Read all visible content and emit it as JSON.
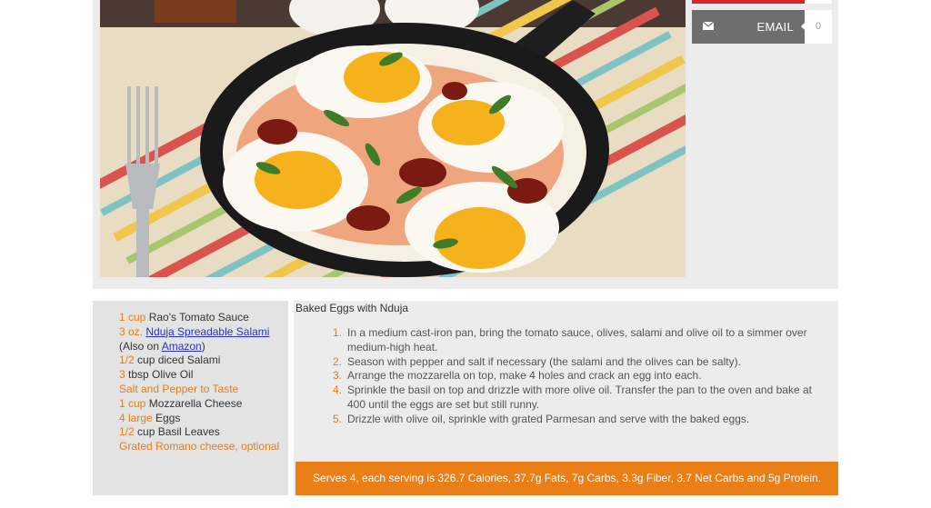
{
  "share": {
    "email_label": "EMAIL",
    "email_count": "0",
    "email_icon": "envelope-icon"
  },
  "photo": {
    "alt": "Baked eggs with nduja in a cast-iron skillet"
  },
  "recipe": {
    "title": "Baked Eggs with Nduja",
    "ingredients": [
      {
        "amount": "1 cup",
        "item": " Rao's Tomato Sauce"
      },
      {
        "amount": "3 oz.",
        "link": "Nduja Spreadable Salami"
      },
      {
        "plain": "(Also on ",
        "link": "Amazon",
        "after": ")"
      },
      {
        "amount": "1/2",
        "item": " cup diced Salami"
      },
      {
        "amount": "3",
        "item": " tbsp Olive Oil"
      },
      {
        "orange": "Salt and Pepper to Taste"
      },
      {
        "amount": "1 cup",
        "item": " Mozzarella Cheese"
      },
      {
        "amount": "4 large",
        "item": " Eggs"
      },
      {
        "amount": "1/2",
        "item": " cup Basil Leaves"
      },
      {
        "orange": "Grated Romano cheese, optional"
      }
    ],
    "steps": [
      {
        "num": "1.",
        "text": "In a medium cast-iron pan, bring the tomato sauce, olives, salami and olive oil to a simmer over medium-high heat."
      },
      {
        "num": "2.",
        "text": "Season with pepper and salt if necessary (the salami and the olives can be salty)."
      },
      {
        "num": "3.",
        "text": "Arrange the mozzarella on top, make 4 holes and crack an egg into each."
      },
      {
        "num": "4.",
        "text": "Sprinkle the basil on top and drizzle with more olive oil. Transfer the pan to the oven and bake at 400 until the eggs are set but still runny."
      },
      {
        "num": "5.",
        "text": "Drizzle with olive oil, sprinkle with grated Parmesan and serve with the baked eggs."
      }
    ],
    "nutrition": "Serves 4, each serving is 326.7 Calories, 37.7g Fats, 7g Carbs, 3.3g Fiber, 3.7 Net Carbs and 5g Protein."
  },
  "colors": {
    "accent": "#ea7f17",
    "share_red": "#d9232d",
    "email_bg": "#6e6e6e",
    "link": "#2a33c9"
  }
}
